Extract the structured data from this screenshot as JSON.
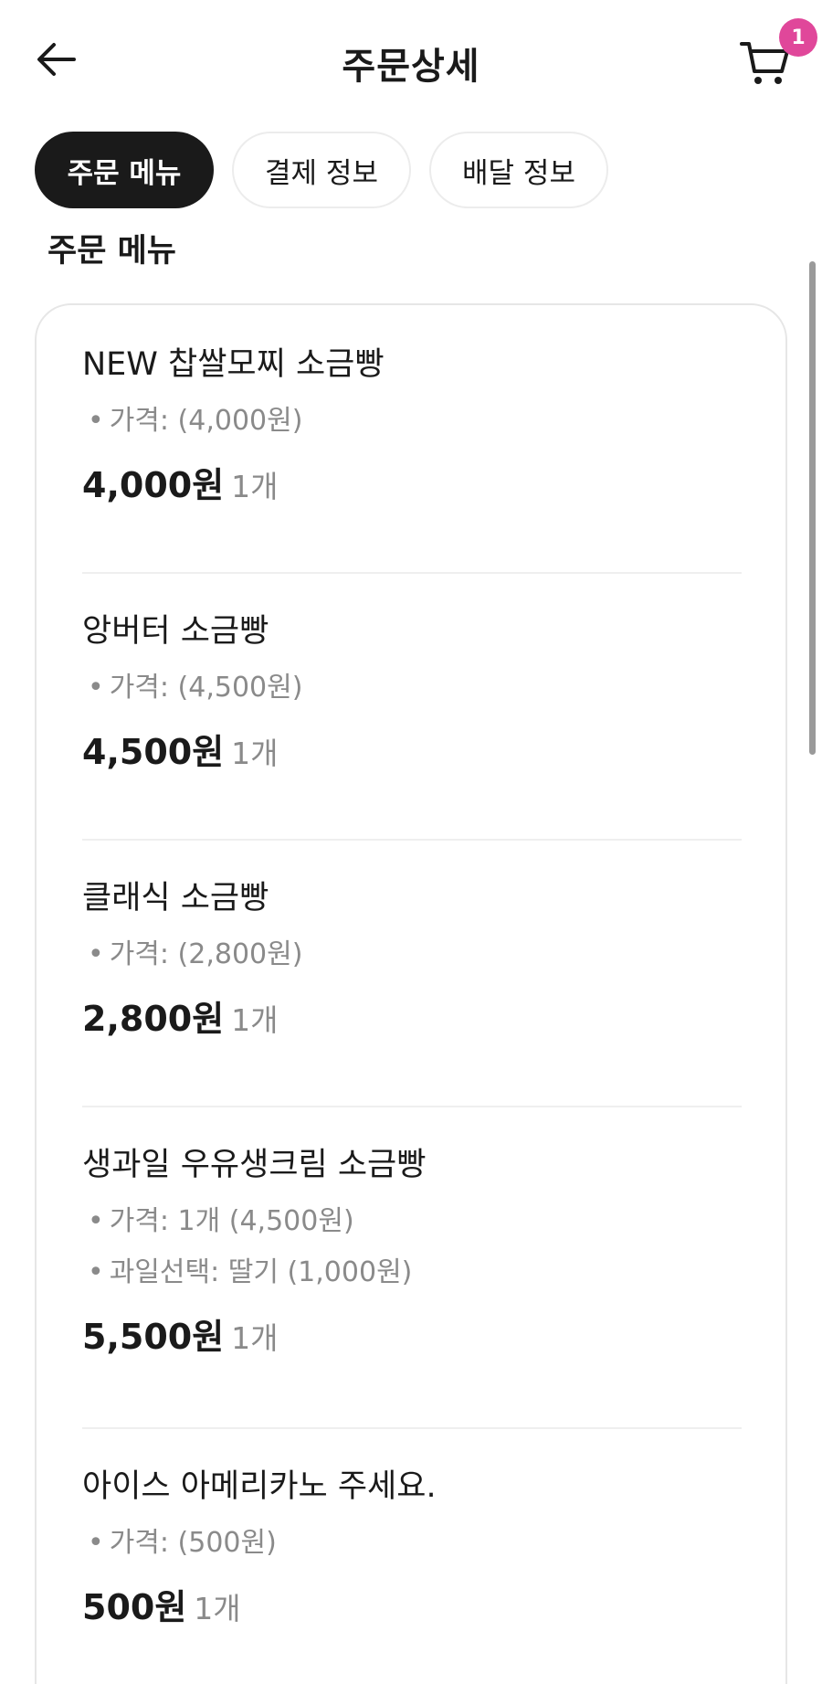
{
  "header": {
    "title": "주문상세",
    "cart_badge": "1"
  },
  "tabs": [
    {
      "label": "주문 메뉴",
      "active": true
    },
    {
      "label": "결제 정보",
      "active": false
    },
    {
      "label": "배달 정보",
      "active": false
    }
  ],
  "section": {
    "title": "주문 메뉴"
  },
  "items": [
    {
      "name": "NEW 찹쌀모찌 소금빵",
      "options": [
        "가격: (4,000원)"
      ],
      "price": "4,000원",
      "qty": "1개"
    },
    {
      "name": "앙버터 소금빵",
      "options": [
        "가격: (4,500원)"
      ],
      "price": "4,500원",
      "qty": "1개"
    },
    {
      "name": "클래식 소금빵",
      "options": [
        "가격: (2,800원)"
      ],
      "price": "2,800원",
      "qty": "1개"
    },
    {
      "name": "생과일 우유생크림 소금빵",
      "options": [
        "가격: 1개 (4,500원)",
        "과일선택: 딸기 (1,000원)"
      ],
      "price": "5,500원",
      "qty": "1개"
    },
    {
      "name": "아이스 아메리카노 주세요.",
      "options": [
        "가격: (500원)"
      ],
      "price": "500원",
      "qty": "1개"
    }
  ],
  "colors": {
    "badge": "#e0479a",
    "active_tab": "#1a1a1a",
    "muted_text": "#8a8a8a"
  }
}
